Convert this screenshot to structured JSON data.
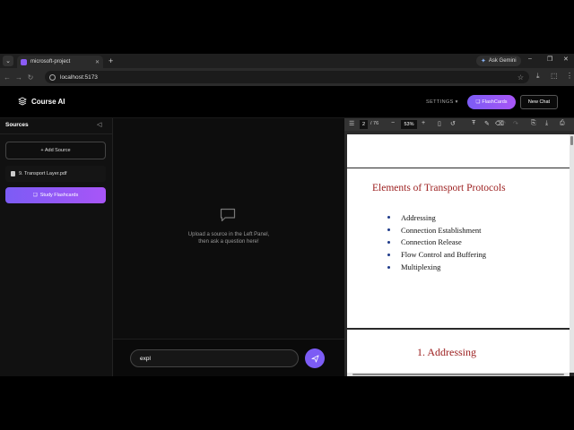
{
  "browser": {
    "tab_title": "microsoft-project",
    "tab_close": "✕",
    "new_tab": "+",
    "gemini_label": "Ask Gemini",
    "url": "localhost:5173",
    "win_min": "–",
    "win_max": "❐",
    "win_close": "✕"
  },
  "app": {
    "name": "Course AI",
    "settings_label": "SETTINGS",
    "flashcards_label": "FlashCards",
    "new_chat_label": "New Chat"
  },
  "sidebar": {
    "title": "Sources",
    "add_source_label": "+ Add Source",
    "sources": [
      {
        "name": "9. Transport Layer.pdf"
      }
    ],
    "study_button_label": "Study Flashcards"
  },
  "chat": {
    "empty_line1": "Upload a source in the Left Panel,",
    "empty_line2": "then ask a question here!",
    "input_value": "expl"
  },
  "pdf": {
    "current_page": "2",
    "page_count": "/ 76",
    "zoom": "53%",
    "page_heading": "Elements of Transport Protocols",
    "bullets": [
      "Addressing",
      "Connection Establishment",
      "Connection Release",
      "Flow Control and Buffering",
      "Multiplexing"
    ],
    "next_page_title": "1. Addressing"
  },
  "colors": {
    "accent": "#7c5cf5",
    "heading_red": "#9b1d1d",
    "bullet_blue": "#1f3b8a"
  }
}
